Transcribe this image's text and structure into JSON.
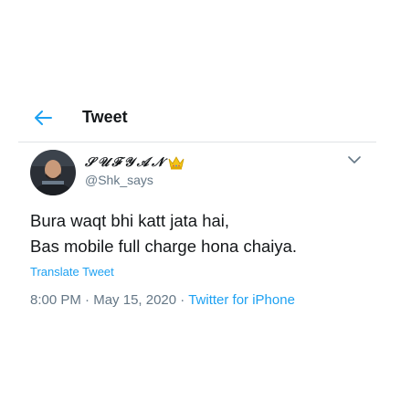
{
  "header": {
    "title": "Tweet",
    "back_icon": "back-arrow-icon",
    "accent": "#1da1f2"
  },
  "user": {
    "display_name": "𝒮𝒰ℱ𝒴𝒜𝒩",
    "display_name_badge": "crown-icon",
    "handle": "@Shk_says"
  },
  "tweet": {
    "lines": [
      "Bura waqt bhi katt jata hai,",
      "Bas mobile full charge hona chaiya."
    ],
    "translate_label": "Translate Tweet",
    "time": "8:00 PM",
    "date": "May 15, 2020",
    "separator": "·",
    "source": "Twitter for iPhone"
  },
  "colors": {
    "text": "#14171a",
    "secondary": "#657786",
    "link": "#1da1f2",
    "divider": "#dfe3e6"
  }
}
